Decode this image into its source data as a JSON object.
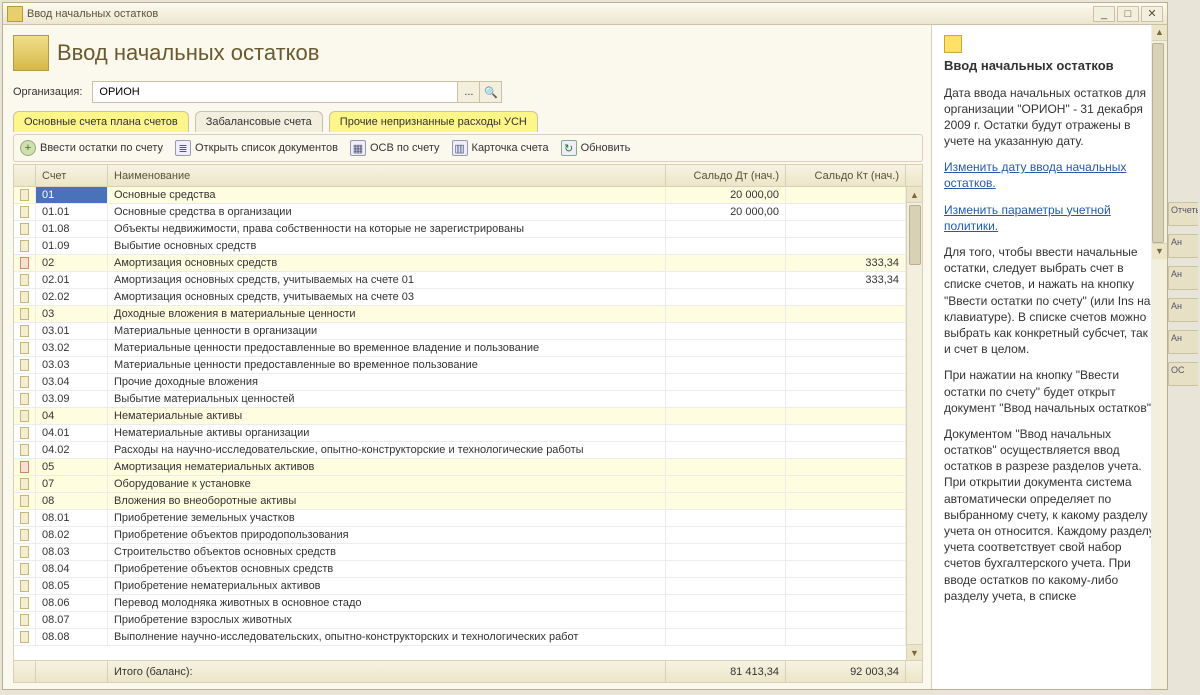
{
  "window": {
    "title": "Ввод начальных остатков",
    "btn_min": "_",
    "btn_max": "□",
    "btn_close": "✕"
  },
  "header": {
    "title": "Ввод начальных остатков"
  },
  "org": {
    "label": "Организация:",
    "value": "ОРИОН",
    "dots": "...",
    "search": "🔍"
  },
  "tabs": {
    "t1": "Основные счета плана счетов",
    "t2": "Забалансовые счета",
    "t3": "Прочие непризнанные расходы УСН"
  },
  "toolbar": {
    "add": "Ввести остатки по счету",
    "openlist": "Открыть список документов",
    "osv": "ОСВ по счету",
    "card": "Карточка счета",
    "refresh": "Обновить"
  },
  "columns": {
    "acct": "Счет",
    "name": "Наименование",
    "dt": "Сальдо Дт (нач.)",
    "kt": "Сальдо Кт (нач.)"
  },
  "rows": [
    {
      "acct": "01",
      "name": "Основные средства",
      "dt": "20 000,00",
      "kt": "",
      "hl": true,
      "sel": true,
      "red": false
    },
    {
      "acct": "01.01",
      "name": "Основные средства в организации",
      "dt": "20 000,00",
      "kt": "",
      "hl": false,
      "red": false
    },
    {
      "acct": "01.08",
      "name": "Объекты недвижимости, права собственности на которые не зарегистрированы",
      "dt": "",
      "kt": "",
      "hl": false,
      "red": false
    },
    {
      "acct": "01.09",
      "name": "Выбытие основных средств",
      "dt": "",
      "kt": "",
      "hl": false,
      "red": false
    },
    {
      "acct": "02",
      "name": "Амортизация основных средств",
      "dt": "",
      "kt": "333,34",
      "hl": true,
      "red": true
    },
    {
      "acct": "02.01",
      "name": "Амортизация основных средств, учитываемых на счете 01",
      "dt": "",
      "kt": "333,34",
      "hl": false,
      "red": false
    },
    {
      "acct": "02.02",
      "name": "Амортизация основных средств, учитываемых на счете 03",
      "dt": "",
      "kt": "",
      "hl": false,
      "red": false
    },
    {
      "acct": "03",
      "name": "Доходные вложения в материальные ценности",
      "dt": "",
      "kt": "",
      "hl": true,
      "red": false
    },
    {
      "acct": "03.01",
      "name": "Материальные ценности в организации",
      "dt": "",
      "kt": "",
      "hl": false,
      "red": false
    },
    {
      "acct": "03.02",
      "name": "Материальные ценности предоставленные во временное владение и пользование",
      "dt": "",
      "kt": "",
      "hl": false,
      "red": false
    },
    {
      "acct": "03.03",
      "name": "Материальные ценности предоставленные во временное пользование",
      "dt": "",
      "kt": "",
      "hl": false,
      "red": false
    },
    {
      "acct": "03.04",
      "name": "Прочие доходные вложения",
      "dt": "",
      "kt": "",
      "hl": false,
      "red": false
    },
    {
      "acct": "03.09",
      "name": "Выбытие материальных ценностей",
      "dt": "",
      "kt": "",
      "hl": false,
      "red": false
    },
    {
      "acct": "04",
      "name": "Нематериальные активы",
      "dt": "",
      "kt": "",
      "hl": true,
      "red": false
    },
    {
      "acct": "04.01",
      "name": "Нематериальные активы организации",
      "dt": "",
      "kt": "",
      "hl": false,
      "red": false
    },
    {
      "acct": "04.02",
      "name": "Расходы на научно-исследовательские, опытно-конструкторские и технологические работы",
      "dt": "",
      "kt": "",
      "hl": false,
      "red": false
    },
    {
      "acct": "05",
      "name": "Амортизация нематериальных активов",
      "dt": "",
      "kt": "",
      "hl": true,
      "red": true
    },
    {
      "acct": "07",
      "name": "Оборудование к установке",
      "dt": "",
      "kt": "",
      "hl": true,
      "red": false
    },
    {
      "acct": "08",
      "name": "Вложения во внеоборотные активы",
      "dt": "",
      "kt": "",
      "hl": true,
      "red": false
    },
    {
      "acct": "08.01",
      "name": "Приобретение земельных участков",
      "dt": "",
      "kt": "",
      "hl": false,
      "red": false
    },
    {
      "acct": "08.02",
      "name": "Приобретение объектов природопользования",
      "dt": "",
      "kt": "",
      "hl": false,
      "red": false
    },
    {
      "acct": "08.03",
      "name": "Строительство объектов основных средств",
      "dt": "",
      "kt": "",
      "hl": false,
      "red": false
    },
    {
      "acct": "08.04",
      "name": "Приобретение объектов основных средств",
      "dt": "",
      "kt": "",
      "hl": false,
      "red": false
    },
    {
      "acct": "08.05",
      "name": "Приобретение нематериальных активов",
      "dt": "",
      "kt": "",
      "hl": false,
      "red": false
    },
    {
      "acct": "08.06",
      "name": "Перевод молодняка животных в основное стадо",
      "dt": "",
      "kt": "",
      "hl": false,
      "red": false
    },
    {
      "acct": "08.07",
      "name": "Приобретение взрослых животных",
      "dt": "",
      "kt": "",
      "hl": false,
      "red": false
    },
    {
      "acct": "08.08",
      "name": "Выполнение научно-исследовательских, опытно-конструкторских и технологических работ",
      "dt": "",
      "kt": "",
      "hl": false,
      "red": false
    }
  ],
  "footer": {
    "label": "Итого (баланс):",
    "dt": "81 413,34",
    "kt": "92 003,34"
  },
  "help": {
    "title": "Ввод начальных остатков",
    "p1": "Дата ввода начальных остатков для организации \"ОРИОН\" - 31 декабря 2009 г. Остатки будут отражены в учете на указанную дату.",
    "link1": "Изменить дату ввода начальных остатков.",
    "link2": "Изменить параметры учетной политики.",
    "p2": "Для того, чтобы ввести начальные остатки, следует выбрать счет в списке счетов, и нажать на кнопку \"Ввести остатки по счету\" (или Ins на клавиатуре). В списке счетов можно выбрать как конкретный субсчет, так и счет в целом.",
    "p3": "При нажатии на кнопку \"Ввести остатки по счету\" будет открыт документ \"Ввод начальных остатков\".",
    "p4": "Документом \"Ввод начальных остатков\" осуществляется ввод остатков в разрезе разделов учета. При открытии документа система автоматически определяет по выбранному счету, к какому разделу учета он относится. Каждому разделу учета соответствует свой набор счетов бухгалтерского учета. При вводе остатков по какому-либо разделу учета, в списке"
  },
  "gutter": {
    "g1": "Отчеты",
    "g2": "Ан",
    "g3": "Ан",
    "g4": "Ан",
    "g5": "Ан",
    "g6": "ОС"
  }
}
